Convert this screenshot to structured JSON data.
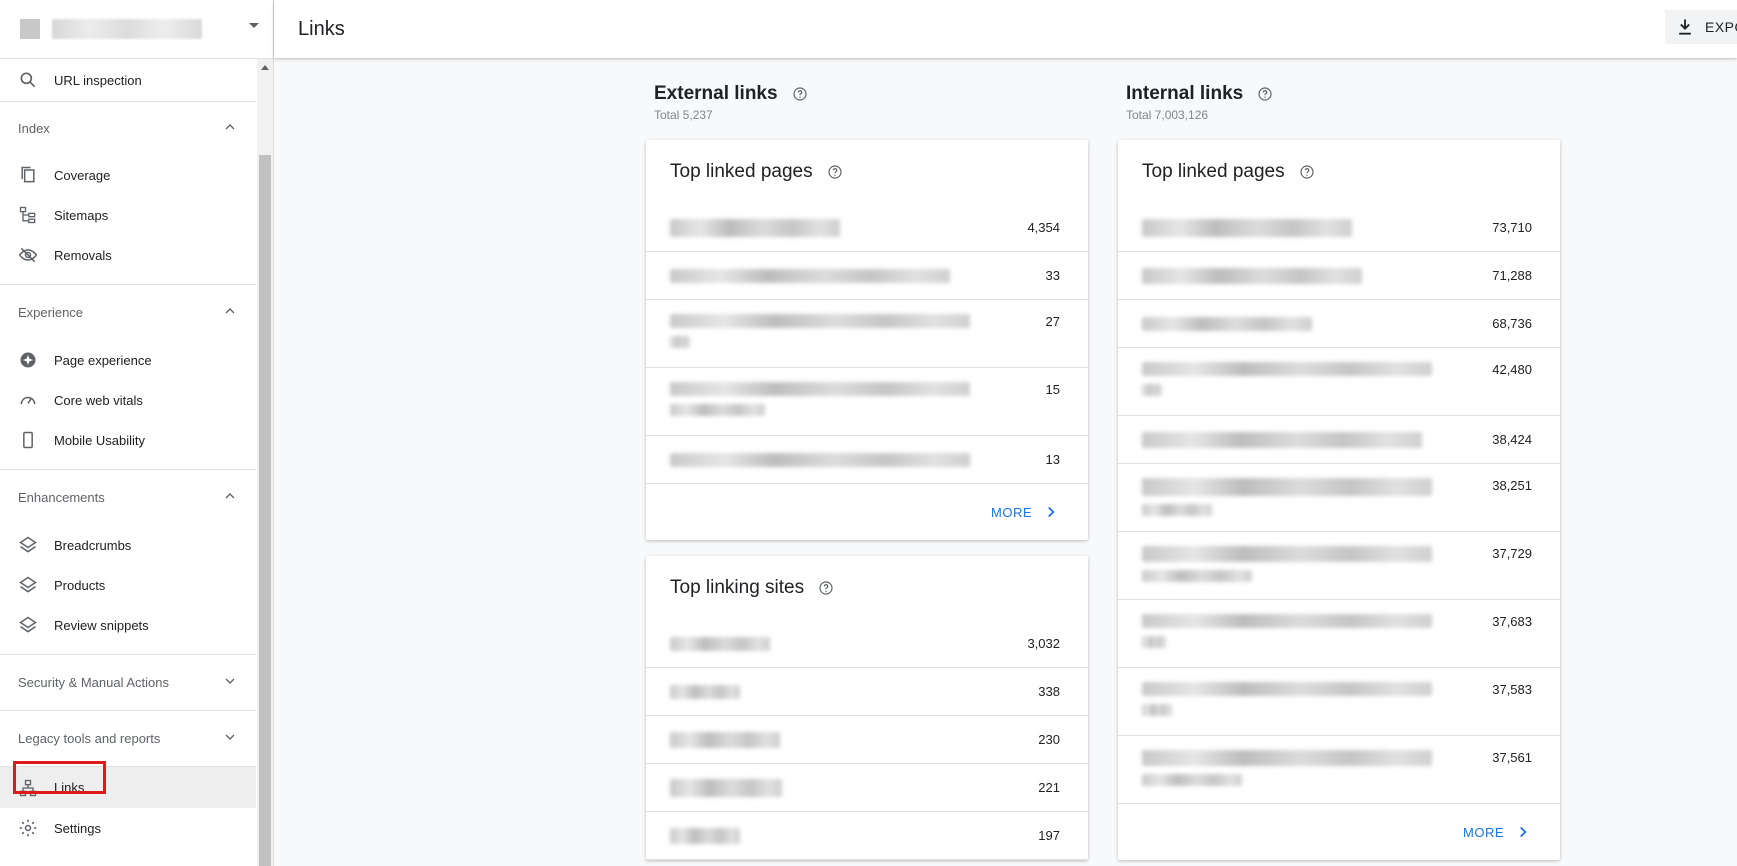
{
  "header": {
    "title": "Links",
    "export_label": "EXPO"
  },
  "sidebar": {
    "url_inspection": "URL inspection",
    "sections": {
      "index": {
        "label": "Index",
        "items": [
          "Coverage",
          "Sitemaps",
          "Removals"
        ]
      },
      "experience": {
        "label": "Experience",
        "items": [
          "Page experience",
          "Core web vitals",
          "Mobile Usability"
        ]
      },
      "enhancements": {
        "label": "Enhancements",
        "items": [
          "Breadcrumbs",
          "Products",
          "Review snippets"
        ]
      },
      "security": {
        "label": "Security & Manual Actions"
      },
      "legacy": {
        "label": "Legacy tools and reports"
      }
    },
    "links": "Links",
    "settings": "Settings"
  },
  "external": {
    "title": "External links",
    "total": "Total 5,237",
    "top_linked_pages": {
      "title": "Top linked pages",
      "values": [
        "4,354",
        "33",
        "27",
        "15",
        "13"
      ],
      "more": "MORE"
    },
    "top_linking_sites": {
      "title": "Top linking sites",
      "values": [
        "3,032",
        "338",
        "230",
        "221",
        "197"
      ]
    }
  },
  "internal": {
    "title": "Internal links",
    "total": "Total 7,003,126",
    "top_linked_pages": {
      "title": "Top linked pages",
      "values": [
        "73,710",
        "71,288",
        "68,736",
        "42,480",
        "38,424",
        "38,251",
        "37,729",
        "37,683",
        "37,583",
        "37,561"
      ],
      "more": "MORE"
    }
  },
  "colors": {
    "accent": "#1a73e8",
    "highlight": "#e01919"
  }
}
